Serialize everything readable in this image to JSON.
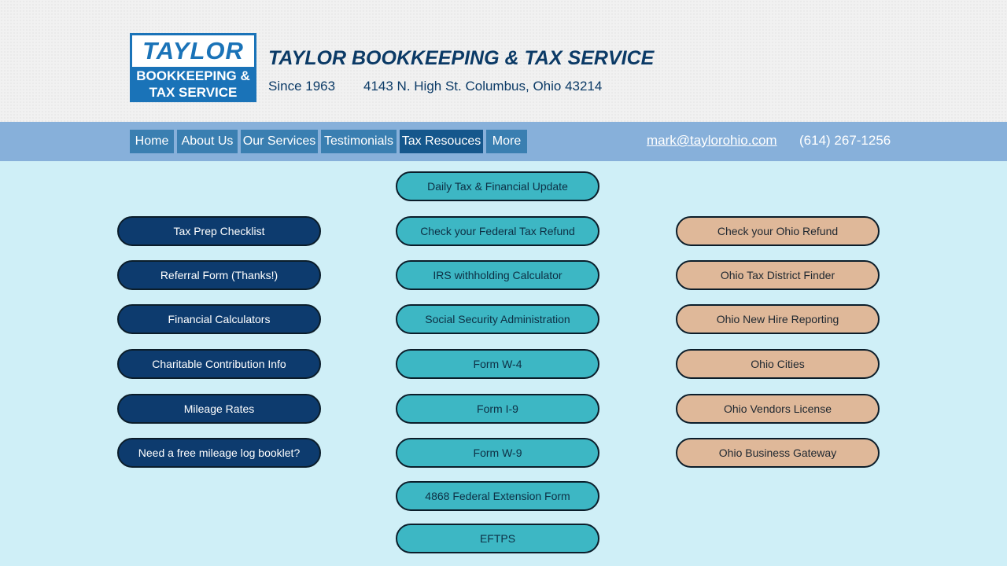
{
  "header": {
    "logo": {
      "name": "TAYLOR",
      "line1": "BOOKKEEPING &",
      "line2": "TAX SERVICE"
    },
    "title": "TAYLOR BOOKKEEPING & TAX SERVICE",
    "since": "Since 1963",
    "address": "4143 N. High St. Columbus, Ohio 43214"
  },
  "nav": {
    "items": [
      {
        "label": "Home"
      },
      {
        "label": "About Us"
      },
      {
        "label": "Our Services"
      },
      {
        "label": "Testimonials"
      },
      {
        "label": "Tax Resouces"
      },
      {
        "label": "More"
      }
    ],
    "email": "mark@taylorohio.com",
    "phone": "(614) 267-1256"
  },
  "columns": {
    "left": [
      "Tax Prep Checklist",
      "Referral Form (Thanks!)",
      "Financial Calculators",
      "Charitable Contribution Info",
      "Mileage Rates",
      "Need a free mileage log booklet?"
    ],
    "middle": [
      "Daily Tax & Financial Update",
      "Check your Federal Tax Refund",
      "IRS withholding Calculator",
      "Social Security Administration",
      "Form W-4",
      "Form I-9",
      "Form W-9",
      "4868 Federal Extension Form",
      "EFTPS"
    ],
    "right": [
      "Check your Ohio Refund",
      "Ohio Tax District Finder",
      "Ohio New Hire Reporting",
      "Ohio Cities",
      "Ohio Vendors License",
      "Ohio Business Gateway"
    ]
  },
  "colors": {
    "nav_bar": "#87b0da",
    "nav_button": "#3a7fb1",
    "nav_active": "#15578c",
    "left_buttons": "#0d3b6e",
    "middle_buttons": "#3db7c4",
    "right_buttons": "#dfb899",
    "page_background": "#cfeff7"
  }
}
